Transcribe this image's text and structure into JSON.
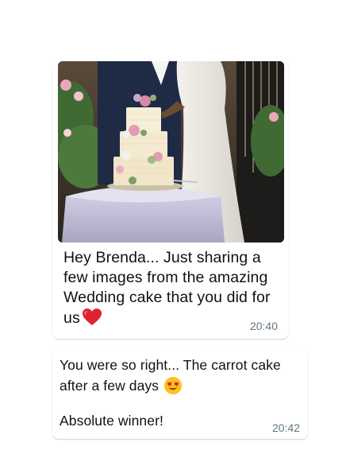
{
  "chat": {
    "messages": [
      {
        "type": "image_with_caption",
        "caption_lines": [
          "Hey Brenda... Just sharing a",
          "few images from the amazing",
          "Wedding cake that you did for",
          "us"
        ],
        "emoji": "heart",
        "time": "20:40"
      },
      {
        "type": "text",
        "lines": [
          "You were so right... The carrot cake",
          "after a few days"
        ],
        "emoji": "heart-eyes",
        "line_final": "Absolute winner!",
        "time": "20:42"
      }
    ]
  }
}
